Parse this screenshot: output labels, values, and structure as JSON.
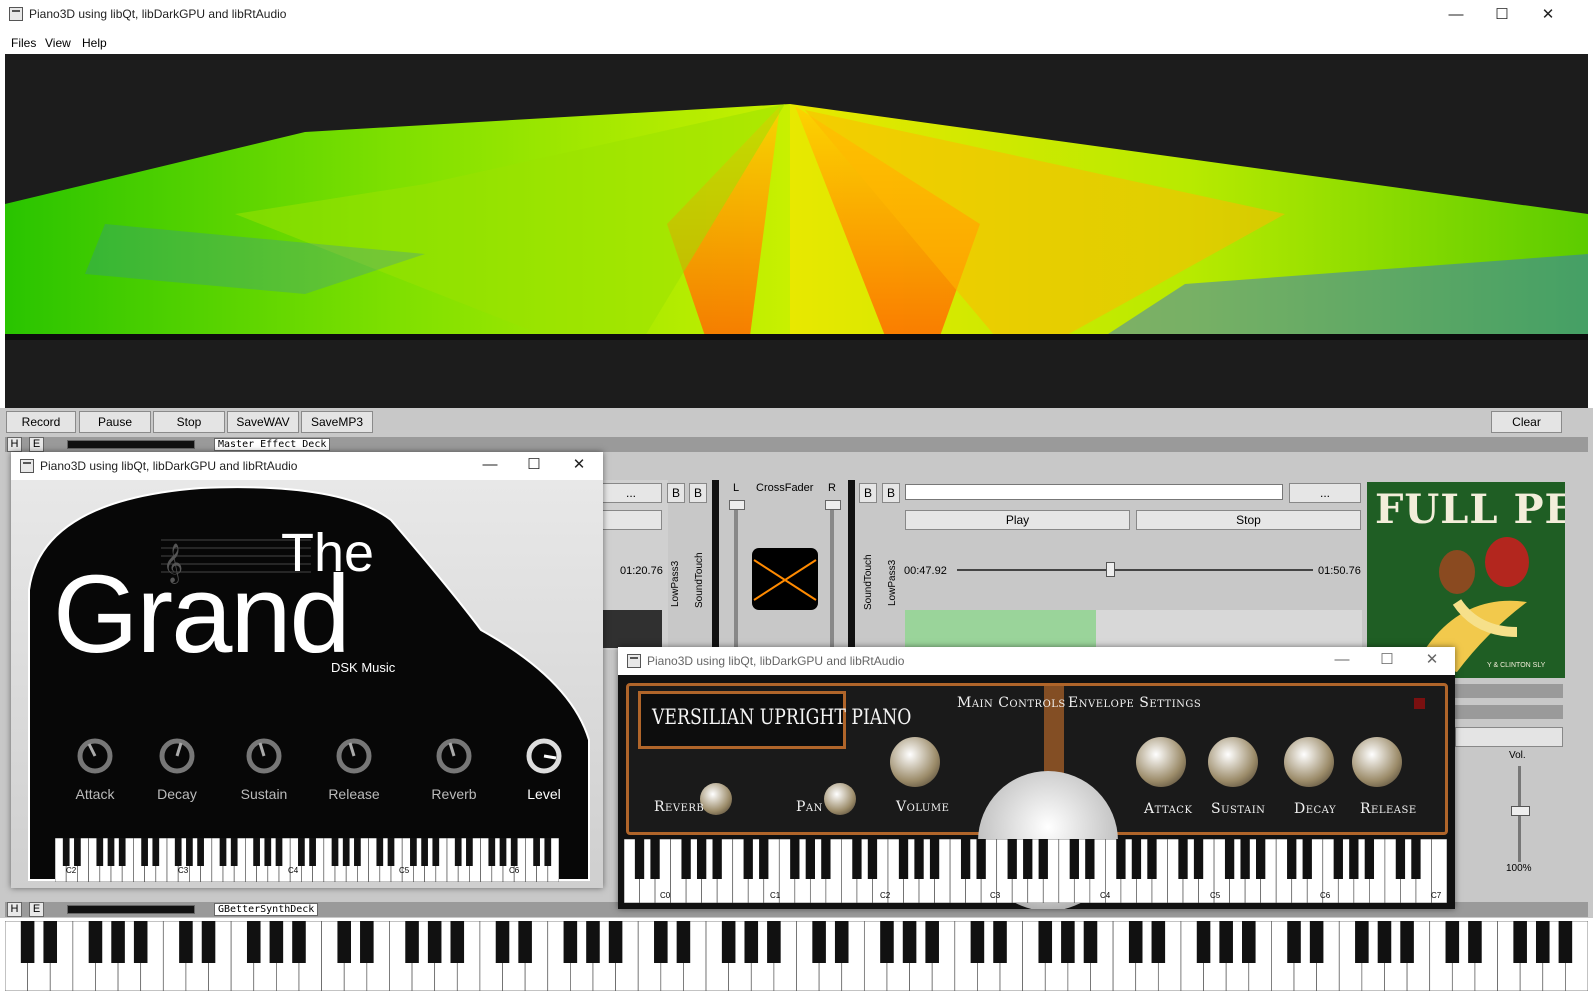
{
  "window": {
    "title": "Piano3D using libQt, libDarkGPU and libRtAudio",
    "controls": {
      "minimize": "—",
      "maximize": "☐",
      "close": "✕"
    }
  },
  "menu": {
    "items": [
      "Files",
      "View",
      "Help"
    ]
  },
  "toolbar": {
    "record": "Record",
    "pause": "Pause",
    "stop": "Stop",
    "save_wav": "SaveWAV",
    "save_mp3": "SaveMP3",
    "clear": "Clear"
  },
  "decks": {
    "master": {
      "h": "H",
      "e": "E",
      "label": "Master Effect Deck"
    },
    "synth": {
      "h": "H",
      "e": "E",
      "label": "GBetterSynthDeck"
    }
  },
  "left_player": {
    "more": "...",
    "b1": "B",
    "b2": "B",
    "time_total": "01:20.76",
    "effect_a": "LowPass3",
    "effect_b": "SoundTouch"
  },
  "crossfader": {
    "label": "CrossFader",
    "left": "L",
    "right": "R"
  },
  "right_player": {
    "b1": "B",
    "b2": "B",
    "more": "...",
    "play": "Play",
    "stop": "Stop",
    "time_pos": "00:47.92",
    "time_total": "01:50.76",
    "position_fraction": 0.43,
    "effect_a": "SoundTouch",
    "effect_b": "LowPass3"
  },
  "album": {
    "title": "FULL PEEL",
    "credit": "Y & CLINTON SLY"
  },
  "volume": {
    "label": "Vol.",
    "value": "100%"
  },
  "grand_window": {
    "title": "Piano3D using libQt, libDarkGPU and libRtAudio",
    "product_small": "The",
    "product_big": "Grand",
    "maker": "DSK Music",
    "knobs": [
      "Attack",
      "Decay",
      "Sustain",
      "Release",
      "Reverb",
      "Level"
    ],
    "octaves": [
      "C2",
      "C3",
      "C4",
      "C5",
      "C6"
    ]
  },
  "versilian_window": {
    "title": "Piano3D using libQt, libDarkGPU and libRtAudio",
    "product": "VERSILIAN UPRIGHT PIANO",
    "main_controls": "Main Controls",
    "envelope": "Envelope Settings",
    "left_knobs": [
      "Reverb",
      "Pan",
      "Volume"
    ],
    "env_knobs": [
      "Attack",
      "Sustain",
      "Decay",
      "Release"
    ],
    "octaves": [
      "C0",
      "C1",
      "C2",
      "C3",
      "C4",
      "C5",
      "C6",
      "C7"
    ]
  },
  "colors": {
    "accent_orange": "#ff8a00",
    "terrain_green": "#3cd400",
    "copper": "#b0652a"
  }
}
